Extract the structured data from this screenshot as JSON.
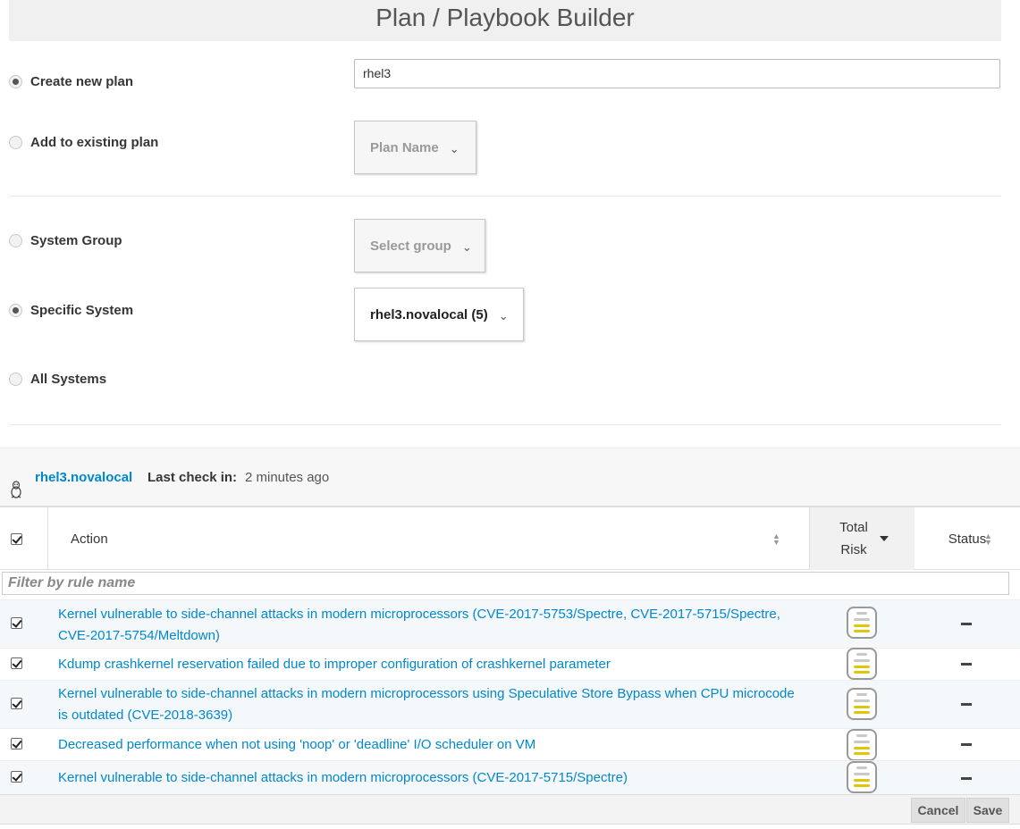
{
  "title": "Plan / Playbook Builder",
  "plan": {
    "create_label": "Create new plan",
    "create_checked": true,
    "existing_label": "Add to existing plan",
    "existing_checked": false,
    "name_value": "rhel3",
    "plan_dropdown": "Plan Name"
  },
  "targets": {
    "group_label": "System Group",
    "group_checked": false,
    "group_dropdown": "Select group",
    "specific_label": "Specific System",
    "specific_checked": true,
    "specific_dropdown": "rhel3.novalocal (5)",
    "all_label": "All Systems",
    "all_checked": false
  },
  "system": {
    "os_icon": "linux-penguin-icon",
    "name": "rhel3.novalocal",
    "last_check_label": "Last check in:",
    "last_check_value": "2 minutes ago"
  },
  "table": {
    "col_action": "Action",
    "col_total_risk": "Total Risk",
    "col_status": "Status",
    "filter_placeholder": "Filter by rule name",
    "select_all_checked": true,
    "rows": [
      {
        "checked": true,
        "action": "Kernel vulnerable to side-channel attacks in modern microprocessors (CVE-2017-5753/Spectre, CVE-2017-5715/Spectre, CVE-2017-5754/Meltdown)",
        "risk_level": 2,
        "status": "—"
      },
      {
        "checked": true,
        "action": "Kdump crashkernel reservation failed due to improper configuration of crashkernel parameter",
        "risk_level": 2,
        "status": "—"
      },
      {
        "checked": true,
        "action": "Kernel vulnerable to side-channel attacks in modern microprocessors using Speculative Store Bypass when CPU microcode is outdated (CVE-2018-3639)",
        "risk_level": 2,
        "status": "—"
      },
      {
        "checked": true,
        "action": "Decreased performance when not using 'noop' or 'deadline' I/O scheduler on VM",
        "risk_level": 2,
        "status": "—"
      },
      {
        "checked": true,
        "action": "Kernel vulnerable to side-channel attacks in modern microprocessors (CVE-2017-5715/Spectre)",
        "risk_level": 2,
        "status": "—"
      }
    ]
  },
  "footer": {
    "cancel": "Cancel",
    "save": "Save"
  },
  "colors": {
    "link": "#0088ce",
    "risk_moderate": "#e0c60a"
  }
}
